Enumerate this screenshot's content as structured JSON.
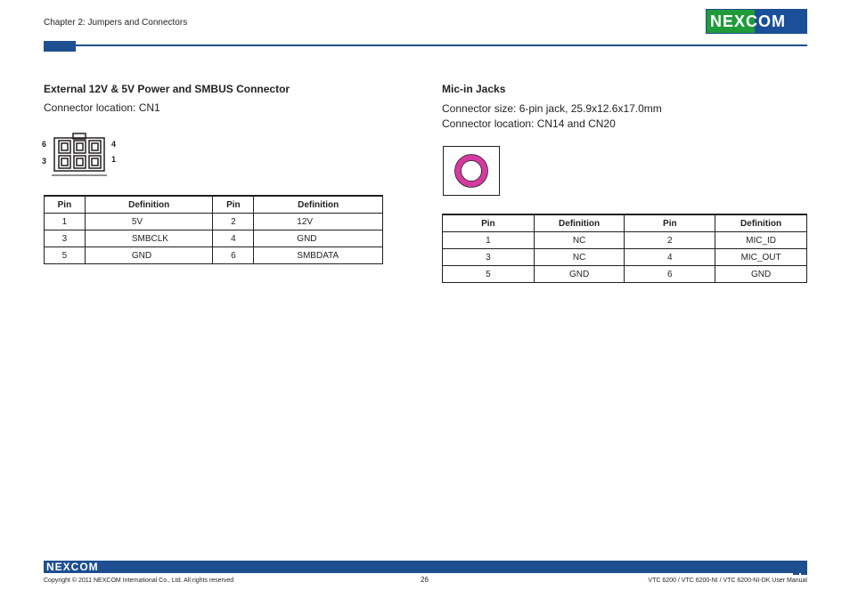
{
  "header": {
    "chapter": "Chapter 2: Jumpers and Connectors",
    "logo": "NEXCOM"
  },
  "left": {
    "title": "External 12V & 5V Power and SMBUS Connector",
    "location": "Connector location: CN1",
    "pin_labels": {
      "top_left": "6",
      "bottom_left": "3",
      "top_right": "4",
      "bottom_right": "1"
    },
    "table": {
      "headers": [
        "Pin",
        "Definition",
        "Pin",
        "Definition"
      ],
      "rows": [
        [
          "1",
          "5V",
          "2",
          "12V"
        ],
        [
          "3",
          "SMBCLK",
          "4",
          "GND"
        ],
        [
          "5",
          "GND",
          "6",
          "SMBDATA"
        ]
      ]
    }
  },
  "right": {
    "title": "Mic-in Jacks",
    "size": "Connector size: 6-pin jack, 25.9x12.6x17.0mm",
    "location": "Connector location: CN14 and CN20",
    "jack_color": "#d63aa0",
    "table": {
      "headers": [
        "Pin",
        "Definition",
        "Pin",
        "Definition"
      ],
      "rows": [
        [
          "1",
          "NC",
          "2",
          "MIC_ID"
        ],
        [
          "3",
          "NC",
          "4",
          "MIC_OUT"
        ],
        [
          "5",
          "GND",
          "6",
          "GND"
        ]
      ]
    }
  },
  "footer": {
    "logo": "NEXCOM",
    "copyright": "Copyright © 2011 NEXCOM International Co., Ltd. All rights reserved",
    "page": "26",
    "manual": "VTC 6200 / VTC 6200-NI / VTC 6200-NI-DK User Manual"
  }
}
